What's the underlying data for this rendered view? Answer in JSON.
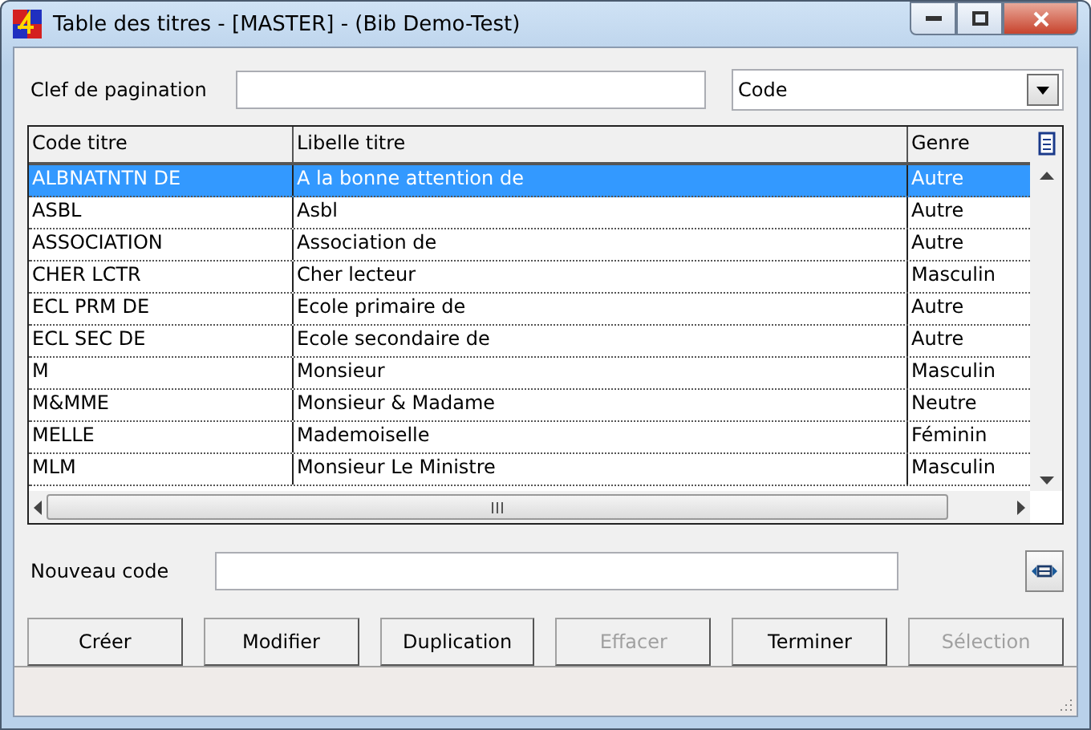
{
  "window": {
    "title": "Table des titres - [MASTER] - (Bib Demo-Test)"
  },
  "pagination": {
    "label": "Clef de pagination",
    "sort": "Code"
  },
  "table": {
    "columns": [
      "Code titre",
      "Libelle titre",
      "Genre"
    ],
    "rows": [
      {
        "cells": [
          "ALBNATNTN DE",
          "A la bonne attention de",
          "Autre"
        ],
        "selected": true
      },
      {
        "cells": [
          "ASBL",
          "Asbl",
          "Autre"
        ],
        "selected": false
      },
      {
        "cells": [
          "ASSOCIATION",
          "Association de",
          "Autre"
        ],
        "selected": false
      },
      {
        "cells": [
          "CHER LCTR",
          "Cher lecteur",
          "Masculin"
        ],
        "selected": false
      },
      {
        "cells": [
          "ECL PRM DE",
          "Ecole primaire de",
          "Autre"
        ],
        "selected": false
      },
      {
        "cells": [
          "ECL SEC DE",
          "Ecole secondaire de",
          "Autre"
        ],
        "selected": false
      },
      {
        "cells": [
          "M",
          "Monsieur",
          "Masculin"
        ],
        "selected": false
      },
      {
        "cells": [
          "M&MME",
          "Monsieur & Madame",
          "Neutre"
        ],
        "selected": false
      },
      {
        "cells": [
          "MELLE",
          "Mademoiselle",
          "Féminin"
        ],
        "selected": false
      },
      {
        "cells": [
          "MLM",
          "Monsieur Le Ministre",
          "Masculin"
        ],
        "selected": false
      }
    ]
  },
  "new_code": {
    "label": "Nouveau code"
  },
  "buttons": [
    {
      "label": "Créer",
      "disabled": false
    },
    {
      "label": "Modifier",
      "disabled": false
    },
    {
      "label": "Duplication",
      "disabled": false
    },
    {
      "label": "Effacer",
      "disabled": true
    },
    {
      "label": "Terminer",
      "disabled": false
    },
    {
      "label": "Sélection",
      "disabled": true
    }
  ]
}
